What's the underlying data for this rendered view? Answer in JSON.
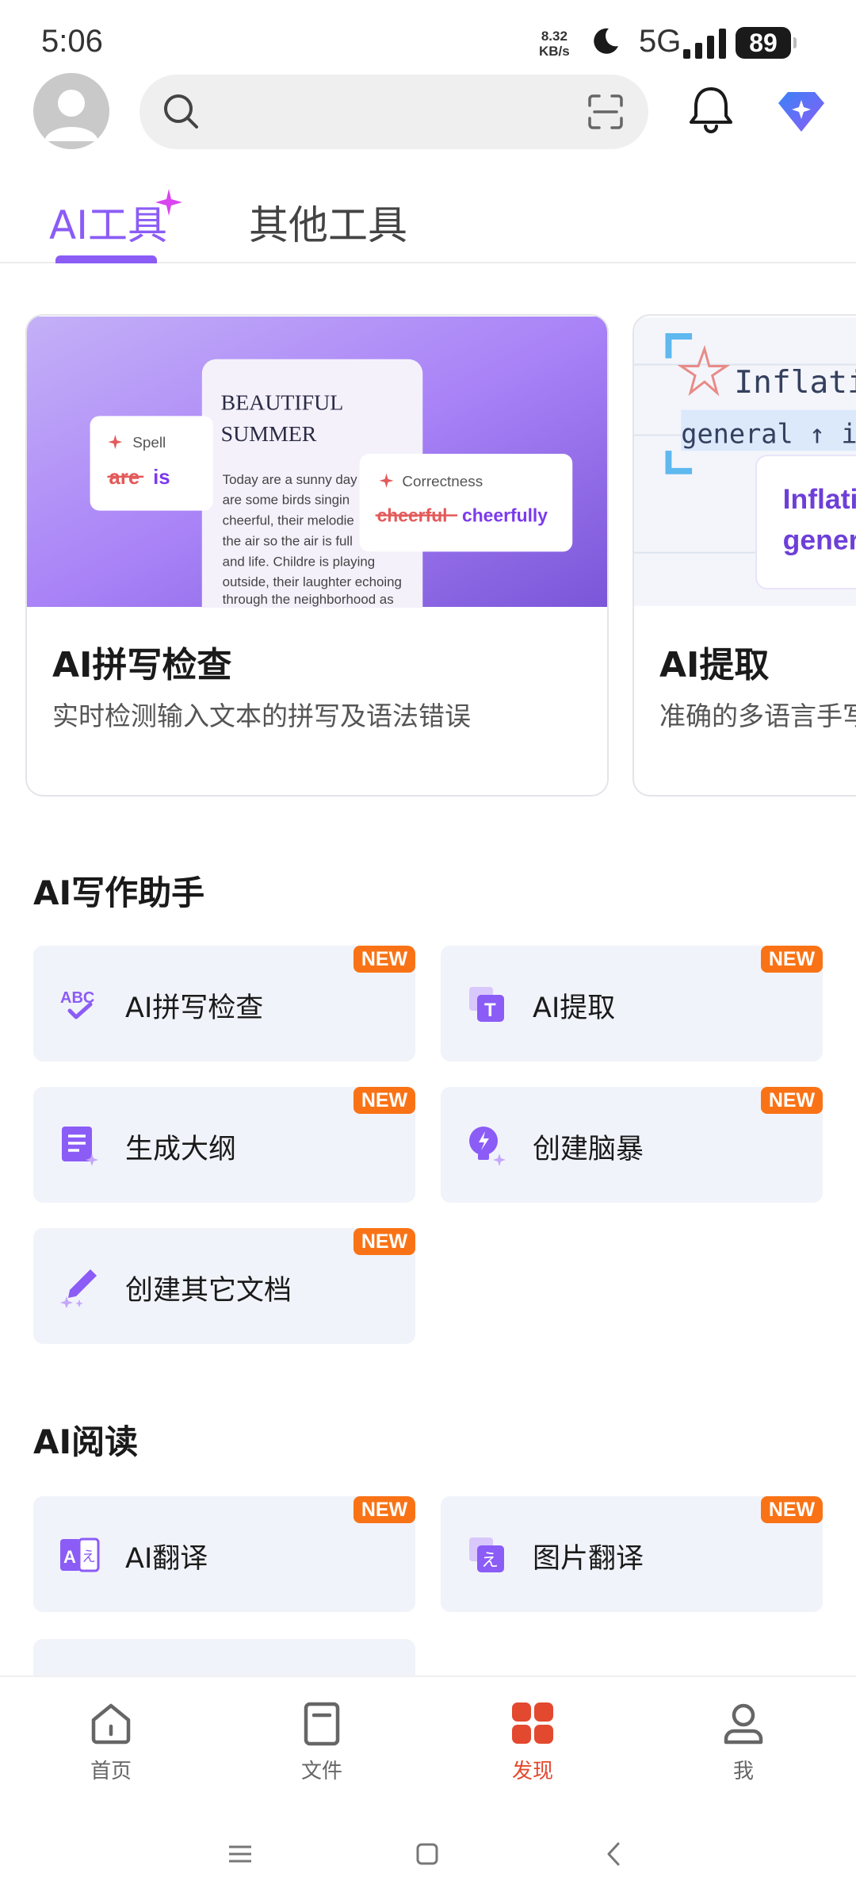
{
  "status_bar": {
    "time": "5:06",
    "speed_value": "8.32",
    "speed_unit": "KB/s",
    "network": "5G",
    "battery": "89"
  },
  "header": {
    "search": {
      "placeholder": ""
    }
  },
  "tabs": [
    {
      "label": "AI工具",
      "active": true
    },
    {
      "label": "其他工具",
      "active": false
    }
  ],
  "featured_cards": [
    {
      "title": "AI拼写检查",
      "description": "实时检测输入文本的拼写及语法错误",
      "preview": {
        "doc_title_1": "BEAUTIFUL",
        "doc_title_2": "SUMMER",
        "doc_lines": [
          "Today are a sunny day",
          "are some birds  singin",
          "cheerful, their melodie",
          "the air so the air is full",
          "and life. Childre is playing",
          "outside, their laughter echoing",
          "through the neighborhood as"
        ],
        "spell_label": "Spell",
        "spell_wrong": "are",
        "spell_fix": "is",
        "correct_label": "Correctness",
        "correct_wrong": "cheerful",
        "correct_fix": "cheerfully"
      }
    },
    {
      "title": "AI提取",
      "description": "准确的多语言手写",
      "preview": {
        "line1": "Inflatio",
        "line2": "general ↑ in",
        "box1": "Inflati",
        "box2": "gener"
      }
    }
  ],
  "sections": [
    {
      "title": "AI写作助手",
      "items": [
        {
          "label": "AI拼写检查",
          "icon": "spellcheck-icon",
          "badge": "NEW"
        },
        {
          "label": "AI提取",
          "icon": "text-extract-icon",
          "badge": "NEW"
        },
        {
          "label": "生成大纲",
          "icon": "outline-icon",
          "badge": "NEW"
        },
        {
          "label": "创建脑暴",
          "icon": "brainstorm-bulb-icon",
          "badge": "NEW"
        },
        {
          "label": "创建其它文档",
          "icon": "pen-sparkle-icon",
          "badge": "NEW"
        }
      ]
    },
    {
      "title": "AI阅读",
      "items": [
        {
          "label": "AI翻译",
          "icon": "translate-icon",
          "badge": "NEW"
        },
        {
          "label": "图片翻译",
          "icon": "image-translate-icon",
          "badge": "NEW"
        }
      ]
    }
  ],
  "bottom_nav": [
    {
      "label": "首页",
      "icon": "home-icon",
      "active": false
    },
    {
      "label": "文件",
      "icon": "file-icon",
      "active": false
    },
    {
      "label": "发现",
      "icon": "discover-grid-icon",
      "active": true
    },
    {
      "label": "我",
      "icon": "profile-icon",
      "active": false
    }
  ],
  "colors": {
    "accent": "#8b5cf6",
    "badge": "#f97316",
    "nav_active": "#e3492f",
    "tile_bg": "#f1f3fa"
  }
}
